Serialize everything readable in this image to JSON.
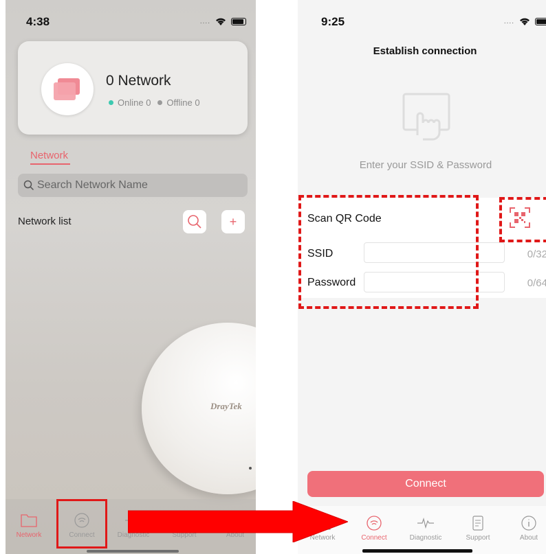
{
  "left": {
    "status_time": "4:38",
    "network_card": {
      "title": "0 Network",
      "online": "Online 0",
      "offline": "Offline 0"
    },
    "tab_label": "Network",
    "search_placeholder": "Search Network Name",
    "list_title": "Network list",
    "add_label": "+",
    "brand": "DrayTek",
    "tabs": [
      "Network",
      "Connect",
      "Diagnostic",
      "Support",
      "About"
    ]
  },
  "right": {
    "status_time": "9:25",
    "header": "Establish connection",
    "prompt": "Enter your SSID & Password",
    "scan_label": "Scan QR Code",
    "ssid_label": "SSID",
    "ssid_count": "0/32",
    "password_label": "Password",
    "password_count": "0/64",
    "connect_button": "Connect",
    "tabs": [
      "Network",
      "Connect",
      "Diagnostic",
      "Support",
      "About"
    ]
  },
  "colors": {
    "accent": "#e8646d",
    "highlight": "#e01818",
    "online": "#3cc9b0",
    "offline": "#9a9a9a",
    "connect_button": "#f0707a"
  }
}
